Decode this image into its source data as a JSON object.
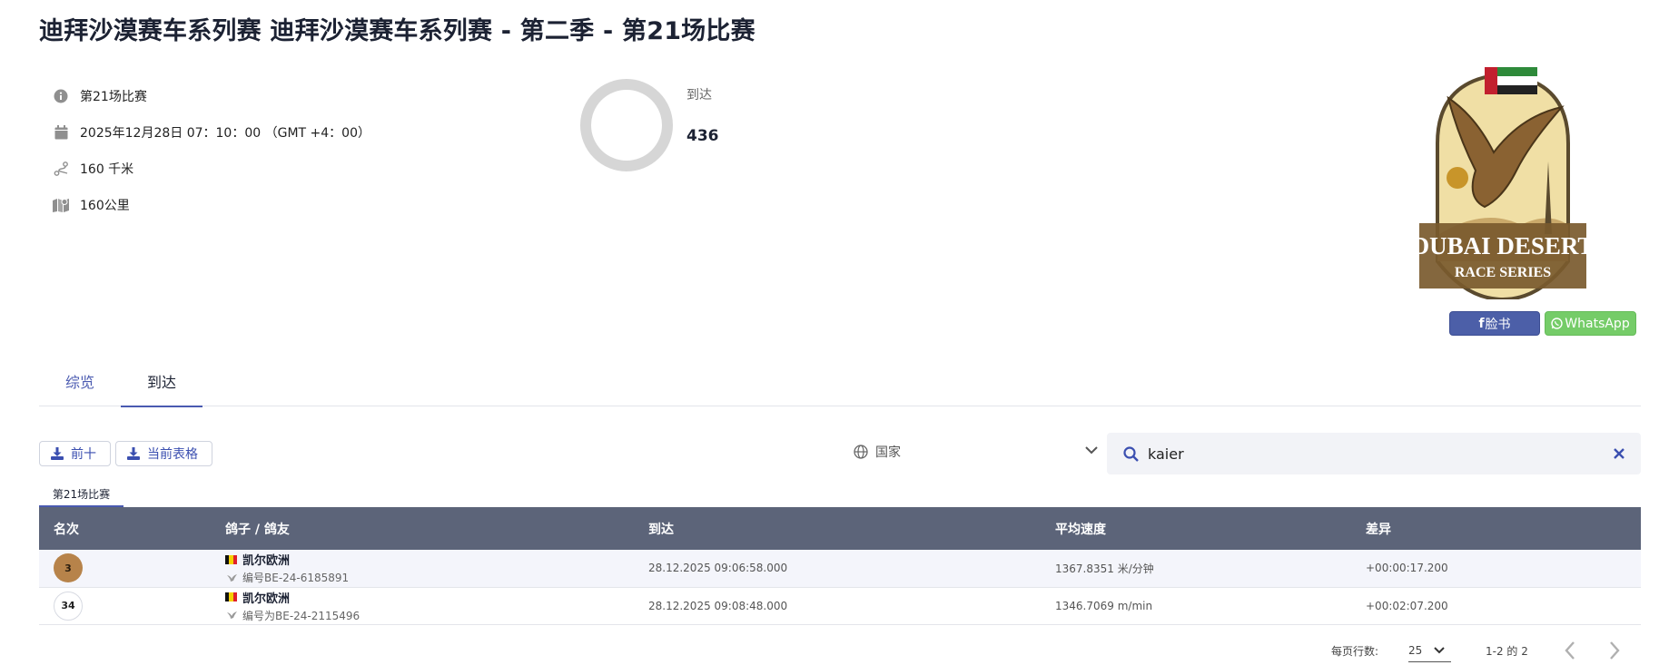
{
  "header": {
    "title": "迪拜沙漠赛车系列赛 迪拜沙漠赛车系列赛 - 第二季 - 第21场比赛"
  },
  "info": {
    "race_name": "第21场比赛",
    "datetime": "2025年12月28日 07：10：00 （GMT +4：00）",
    "distance": "160 千米",
    "distance_alt": "160公里",
    "icons": [
      "info-icon",
      "calendar-icon",
      "route-icon",
      "map-icon"
    ]
  },
  "stats": {
    "arrivals_label": "到达",
    "arrivals_value": "436"
  },
  "logo": {
    "text_line1": "DUBAI DESERT",
    "text_line2": "RACE SERIES"
  },
  "share": {
    "facebook_label": "脸书",
    "whatsapp_label": "WhatsApp"
  },
  "tabs": [
    {
      "label": "综览"
    },
    {
      "label": "到达"
    }
  ],
  "toolbar": {
    "download_top10": "前十",
    "download_table": "当前表格",
    "country_placeholder": "国家",
    "search_value": "kaier"
  },
  "race_tab": "第21场比赛",
  "table": {
    "headers": {
      "rank": "名次",
      "pigeon": "鸽子 / 鸽友",
      "arrival": "到达",
      "speed": "平均速度",
      "diff": "差异"
    },
    "rows": [
      {
        "rank": "3",
        "owner": "凯尔欧洲",
        "ring": "编号BE-24-6185891",
        "arrival": "28.12.2025 09:06:58.000",
        "speed": "1367.8351 米/分钟",
        "diff": "+00:00:17.200"
      },
      {
        "rank": "34",
        "owner": "凯尔欧洲",
        "ring": "编号为BE-24-2115496",
        "arrival": "28.12.2025 09:08:48.000",
        "speed": "1346.7069 m/min",
        "diff": "+00:02:07.200"
      }
    ]
  },
  "pagination": {
    "rows_per_page_label": "每页行数:",
    "rows_per_page": "25",
    "range": "1-2 的 2"
  },
  "colors": {
    "accent": "#4a5ab0",
    "table_header": "#5c6479",
    "diff": "#c23a4a",
    "bronze": "#b7834a",
    "facebook": "#4c5fa8",
    "whatsapp": "#75cc68"
  }
}
